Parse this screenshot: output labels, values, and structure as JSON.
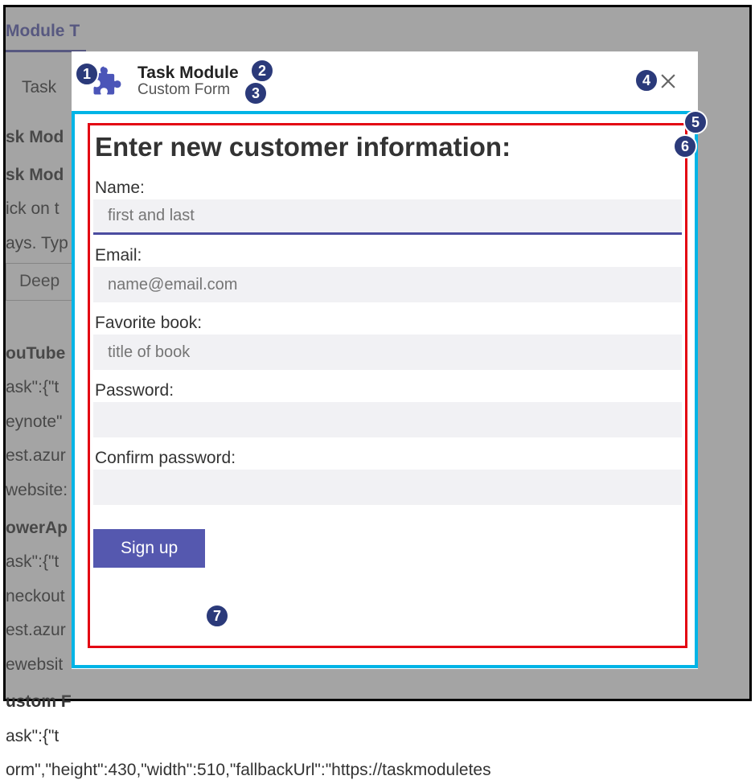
{
  "header": {
    "app_title": "Task Module",
    "app_subtitle": "Custom Form",
    "close_label": "Close"
  },
  "form": {
    "heading": "Enter new customer information:",
    "fields": {
      "name": {
        "label": "Name:",
        "placeholder": "first and last"
      },
      "email": {
        "label": "Email:",
        "placeholder": "name@email.com"
      },
      "book": {
        "label": "Favorite book:",
        "placeholder": "title of book"
      },
      "pwd": {
        "label": "Password:",
        "placeholder": ""
      },
      "pwd2": {
        "label": "Confirm password:",
        "placeholder": ""
      }
    },
    "submit_label": "Sign up"
  },
  "annotations": {
    "1": "App icon",
    "2": "App title",
    "3": "Task module subtitle",
    "4": "Close button",
    "5": "Task module outer iframe boundary",
    "6": "Task module inner content boundary",
    "7": "Submit button"
  },
  "background": {
    "tab": "Module T",
    "row_task": "Task",
    "h1": "sk Mod",
    "h2": "sk Mod",
    "p1": "ick on t",
    "p2": "ays. Typ",
    "btn": "Deep",
    "yt": "ouTube",
    "j1a": "ask\":{\"t",
    "j1b": "eynote\"",
    "j1c": "est.azur",
    "j1d": "website:",
    "pa": "owerAp",
    "j2a": "ask\":{\"t",
    "j2b": "neckout",
    "j2c": "est.azur",
    "j2d": "ewebsit",
    "cf": "ustom F",
    "j3a": "ask\":{\"t",
    "j3b": "orm\",\"height\":430,\"width\":510,\"fallbackUrl\":\"https://taskmoduletes"
  }
}
